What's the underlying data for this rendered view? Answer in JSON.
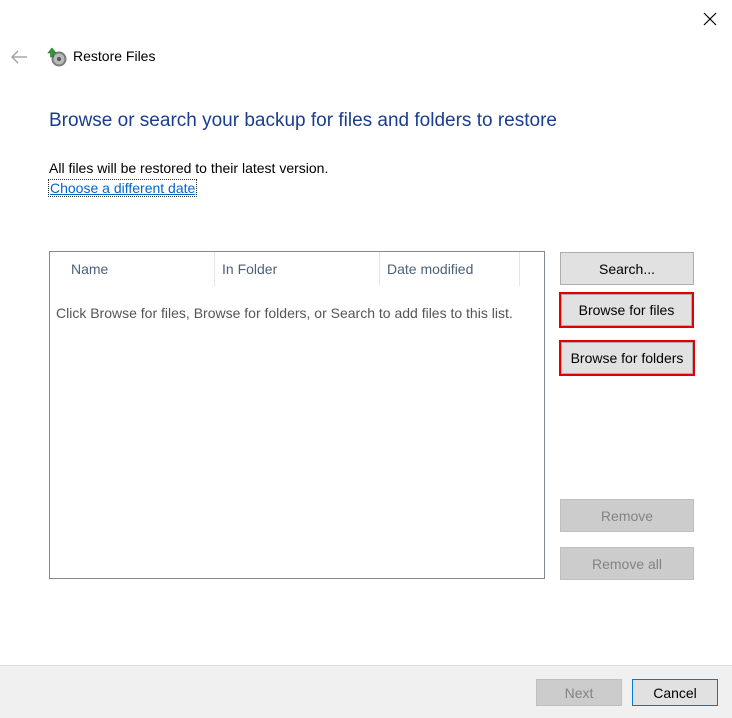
{
  "window": {
    "title": "Restore Files",
    "close_icon": "close-icon",
    "back_icon": "back-arrow-icon",
    "app_icon": "restore-files-icon"
  },
  "main": {
    "heading": "Browse or search your backup for files and folders to restore",
    "info": "All files will be restored to their latest version.",
    "date_link": "Choose a different date"
  },
  "file_list": {
    "columns": [
      "Name",
      "In Folder",
      "Date modified"
    ],
    "empty_message": "Click Browse for files, Browse for folders, or Search to add files to this list."
  },
  "side_buttons": {
    "search": "Search...",
    "browse_files": "Browse for files",
    "browse_folders": "Browse for folders",
    "remove": "Remove",
    "remove_all": "Remove all"
  },
  "footer": {
    "next": "Next",
    "cancel": "Cancel"
  },
  "colors": {
    "heading": "#1b3d8f",
    "link": "#0066cc",
    "highlight": "#e00000"
  }
}
